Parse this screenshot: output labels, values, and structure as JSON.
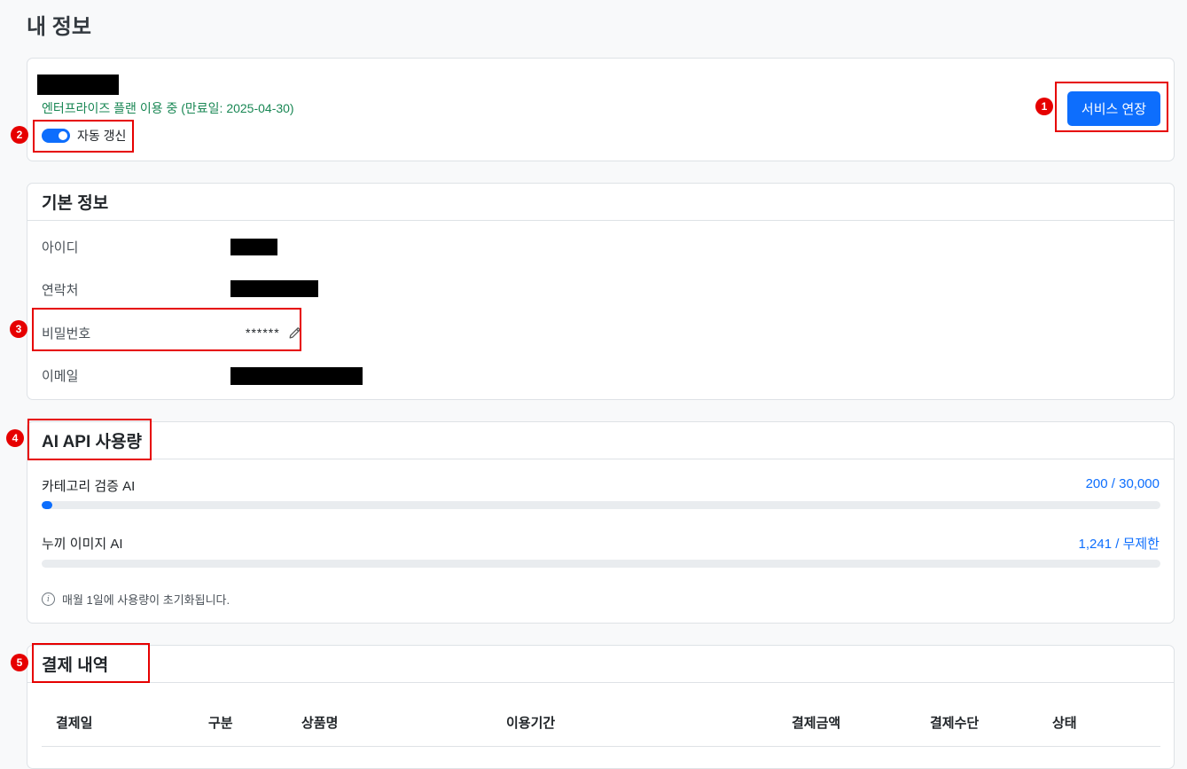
{
  "page": {
    "title": "내 정보"
  },
  "subscription": {
    "plan_text": "엔터프라이즈 플랜 이용 중 (만료일: 2025-04-30)",
    "auto_renew_label": "자동 갱신",
    "auto_renew_on": true,
    "extend_button": "서비스 연장"
  },
  "basic_info": {
    "title": "기본 정보",
    "fields": [
      {
        "label": "아이디"
      },
      {
        "label": "연락처"
      },
      {
        "label": "비밀번호",
        "value": "******"
      },
      {
        "label": "이메일"
      }
    ]
  },
  "api_usage": {
    "title": "AI API 사용량",
    "items": [
      {
        "name": "카테고리 검증 AI",
        "value_text": "200 / 30,000",
        "used": 200,
        "limit": 30000,
        "progress_fraction": 0.0067
      },
      {
        "name": "누끼 이미지 AI",
        "value_text": "1,241 / 무제한",
        "used": 1241,
        "progress_fraction": 0
      }
    ],
    "note": "매월 1일에 사용량이 초기화됩니다."
  },
  "payments": {
    "title": "결제 내역",
    "columns": [
      "결제일",
      "구분",
      "상품명",
      "이용기간",
      "결제금액",
      "결제수단",
      "상태"
    ]
  },
  "annotations": [
    "1",
    "2",
    "3",
    "4",
    "5"
  ],
  "colors": {
    "primary": "#0d6efd",
    "success": "#198754",
    "annotation": "#e60000"
  },
  "icons": {
    "edit": "pencil-icon",
    "info": "info-icon"
  }
}
